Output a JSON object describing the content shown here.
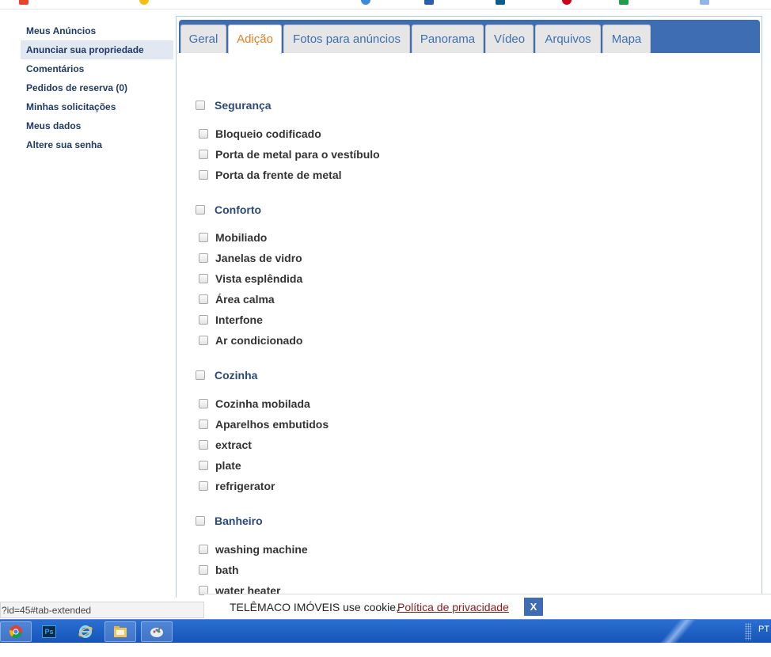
{
  "sidebar": {
    "items": [
      {
        "label": "Meus Anúncios"
      },
      {
        "label": "Anunciar sua propriedade"
      },
      {
        "label": "Comentários"
      },
      {
        "label": "Pedidos de reserva (0)"
      },
      {
        "label": "Minhas solicitações"
      },
      {
        "label": "Meus dados"
      },
      {
        "label": "Altere sua senha"
      }
    ]
  },
  "tabs": [
    {
      "label": "Geral"
    },
    {
      "label": "Adição"
    },
    {
      "label": "Fotos para anúncios"
    },
    {
      "label": "Panorama"
    },
    {
      "label": "Vídeo"
    },
    {
      "label": "Arquivos"
    },
    {
      "label": "Mapa"
    }
  ],
  "active_tab": "Adição",
  "groups": [
    {
      "title": "Segurança",
      "options": [
        "Bloqueio codificado",
        "Porta de metal para o vestíbulo",
        "Porta da frente de metal"
      ]
    },
    {
      "title": "Conforto",
      "options": [
        "Mobiliado",
        "Janelas de vidro",
        "Vista esplêndida",
        "Área calma",
        "Interfone",
        "Ar condicionado"
      ]
    },
    {
      "title": "Cozinha",
      "options": [
        "Cozinha mobilada",
        "Aparelhos embutidos",
        "extract",
        "plate",
        "refrigerator"
      ]
    },
    {
      "title": "Banheiro",
      "options": [
        "washing machine",
        "bath",
        "water heater"
      ]
    }
  ],
  "status_url": "?id=45#tab-extended",
  "cookie": {
    "text": "TELÊMACO IMÓVEIS use cookie,",
    "link": "Política de privacidade",
    "close": "X"
  },
  "taskbar": {
    "icons": [
      "chrome-icon",
      "photoshop-icon",
      "ie-icon",
      "file-explorer-icon",
      "paint-icon"
    ],
    "ps_text": "Ps",
    "lang": "PT"
  },
  "colors": {
    "tab_bar": "#3f6db3",
    "tab_text": "#3d70b2",
    "active_tab_text": "#e67e22",
    "sidebar_text": "#1f3a66",
    "group_title": "#2b4a7a",
    "taskbar": "#1f62c8"
  }
}
